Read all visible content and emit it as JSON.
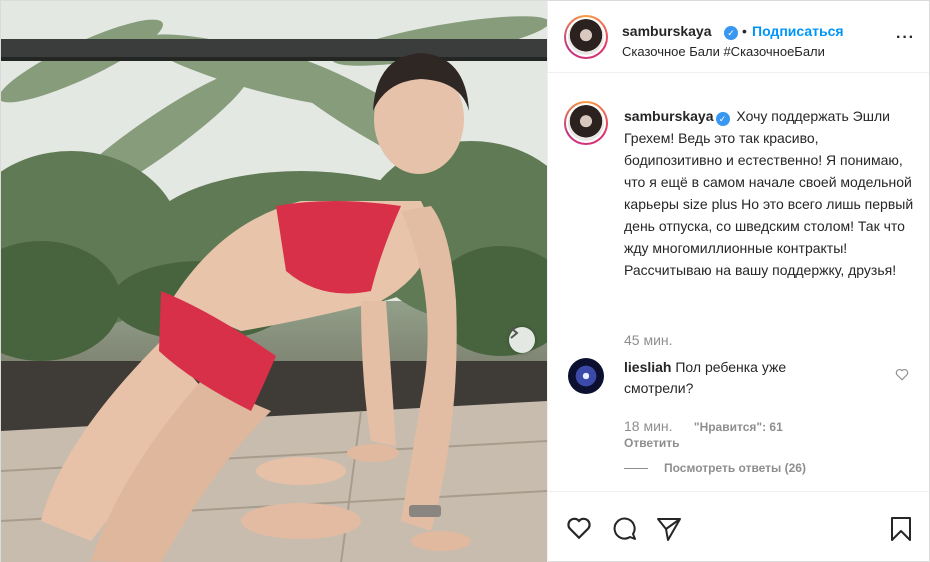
{
  "header": {
    "username": "samburskaya",
    "dot": "•",
    "follow_label": "Подписаться",
    "location": "Сказочное Бали #СказочноеБали"
  },
  "caption": {
    "username": "samburskaya",
    "text": "Хочу поддержать Эшли Грехем! Ведь это так красиво, бодипозитивно и естественно! Я понимаю, что я ещё в самом начале своей модельной карьеры size plus Но это всего лишь первый день отпуска, со шведским столом! Так что жду многомиллионные контракты! Рассчитываю на вашу поддержку, друзья!",
    "time": "45 мин."
  },
  "comment": {
    "username": "liesliah",
    "text": "Пол ребенка уже смотрели?",
    "time": "18 мин.",
    "likes": "\"Нравится\": 61",
    "reply_label": "Ответить",
    "view_replies": "Посмотреть ответы (26)"
  },
  "icons": {
    "like": "heart-icon",
    "comment": "comment-icon",
    "share": "paper-plane-icon",
    "save": "bookmark-icon",
    "more": "more-dots-icon",
    "next": "chevron-right-icon",
    "verified": "verified-badge-icon"
  },
  "colors": {
    "accent": "#0095f6",
    "verified": "#3897f0",
    "muted": "#8e8e8e",
    "bikini": "#d9304a"
  }
}
